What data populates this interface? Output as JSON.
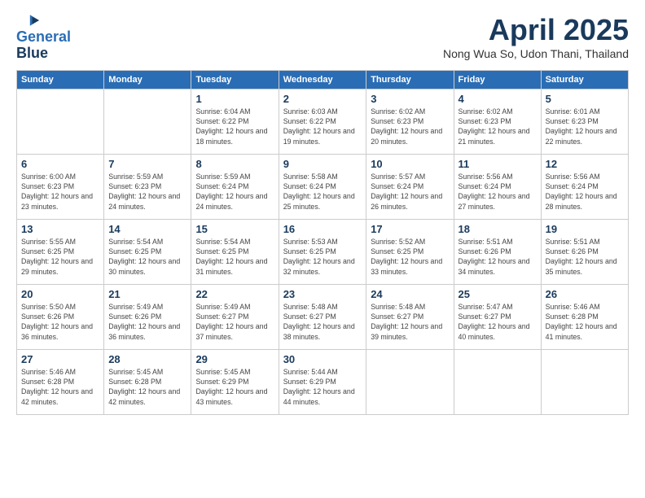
{
  "logo": {
    "line1": "General",
    "line2": "Blue"
  },
  "title": "April 2025",
  "location": "Nong Wua So, Udon Thani, Thailand",
  "days_header": [
    "Sunday",
    "Monday",
    "Tuesday",
    "Wednesday",
    "Thursday",
    "Friday",
    "Saturday"
  ],
  "weeks": [
    [
      {
        "day": "",
        "info": ""
      },
      {
        "day": "",
        "info": ""
      },
      {
        "day": "1",
        "info": "Sunrise: 6:04 AM\nSunset: 6:22 PM\nDaylight: 12 hours and 18 minutes."
      },
      {
        "day": "2",
        "info": "Sunrise: 6:03 AM\nSunset: 6:22 PM\nDaylight: 12 hours and 19 minutes."
      },
      {
        "day": "3",
        "info": "Sunrise: 6:02 AM\nSunset: 6:23 PM\nDaylight: 12 hours and 20 minutes."
      },
      {
        "day": "4",
        "info": "Sunrise: 6:02 AM\nSunset: 6:23 PM\nDaylight: 12 hours and 21 minutes."
      },
      {
        "day": "5",
        "info": "Sunrise: 6:01 AM\nSunset: 6:23 PM\nDaylight: 12 hours and 22 minutes."
      }
    ],
    [
      {
        "day": "6",
        "info": "Sunrise: 6:00 AM\nSunset: 6:23 PM\nDaylight: 12 hours and 23 minutes."
      },
      {
        "day": "7",
        "info": "Sunrise: 5:59 AM\nSunset: 6:23 PM\nDaylight: 12 hours and 24 minutes."
      },
      {
        "day": "8",
        "info": "Sunrise: 5:59 AM\nSunset: 6:24 PM\nDaylight: 12 hours and 24 minutes."
      },
      {
        "day": "9",
        "info": "Sunrise: 5:58 AM\nSunset: 6:24 PM\nDaylight: 12 hours and 25 minutes."
      },
      {
        "day": "10",
        "info": "Sunrise: 5:57 AM\nSunset: 6:24 PM\nDaylight: 12 hours and 26 minutes."
      },
      {
        "day": "11",
        "info": "Sunrise: 5:56 AM\nSunset: 6:24 PM\nDaylight: 12 hours and 27 minutes."
      },
      {
        "day": "12",
        "info": "Sunrise: 5:56 AM\nSunset: 6:24 PM\nDaylight: 12 hours and 28 minutes."
      }
    ],
    [
      {
        "day": "13",
        "info": "Sunrise: 5:55 AM\nSunset: 6:25 PM\nDaylight: 12 hours and 29 minutes."
      },
      {
        "day": "14",
        "info": "Sunrise: 5:54 AM\nSunset: 6:25 PM\nDaylight: 12 hours and 30 minutes."
      },
      {
        "day": "15",
        "info": "Sunrise: 5:54 AM\nSunset: 6:25 PM\nDaylight: 12 hours and 31 minutes."
      },
      {
        "day": "16",
        "info": "Sunrise: 5:53 AM\nSunset: 6:25 PM\nDaylight: 12 hours and 32 minutes."
      },
      {
        "day": "17",
        "info": "Sunrise: 5:52 AM\nSunset: 6:25 PM\nDaylight: 12 hours and 33 minutes."
      },
      {
        "day": "18",
        "info": "Sunrise: 5:51 AM\nSunset: 6:26 PM\nDaylight: 12 hours and 34 minutes."
      },
      {
        "day": "19",
        "info": "Sunrise: 5:51 AM\nSunset: 6:26 PM\nDaylight: 12 hours and 35 minutes."
      }
    ],
    [
      {
        "day": "20",
        "info": "Sunrise: 5:50 AM\nSunset: 6:26 PM\nDaylight: 12 hours and 36 minutes."
      },
      {
        "day": "21",
        "info": "Sunrise: 5:49 AM\nSunset: 6:26 PM\nDaylight: 12 hours and 36 minutes."
      },
      {
        "day": "22",
        "info": "Sunrise: 5:49 AM\nSunset: 6:27 PM\nDaylight: 12 hours and 37 minutes."
      },
      {
        "day": "23",
        "info": "Sunrise: 5:48 AM\nSunset: 6:27 PM\nDaylight: 12 hours and 38 minutes."
      },
      {
        "day": "24",
        "info": "Sunrise: 5:48 AM\nSunset: 6:27 PM\nDaylight: 12 hours and 39 minutes."
      },
      {
        "day": "25",
        "info": "Sunrise: 5:47 AM\nSunset: 6:27 PM\nDaylight: 12 hours and 40 minutes."
      },
      {
        "day": "26",
        "info": "Sunrise: 5:46 AM\nSunset: 6:28 PM\nDaylight: 12 hours and 41 minutes."
      }
    ],
    [
      {
        "day": "27",
        "info": "Sunrise: 5:46 AM\nSunset: 6:28 PM\nDaylight: 12 hours and 42 minutes."
      },
      {
        "day": "28",
        "info": "Sunrise: 5:45 AM\nSunset: 6:28 PM\nDaylight: 12 hours and 42 minutes."
      },
      {
        "day": "29",
        "info": "Sunrise: 5:45 AM\nSunset: 6:29 PM\nDaylight: 12 hours and 43 minutes."
      },
      {
        "day": "30",
        "info": "Sunrise: 5:44 AM\nSunset: 6:29 PM\nDaylight: 12 hours and 44 minutes."
      },
      {
        "day": "",
        "info": ""
      },
      {
        "day": "",
        "info": ""
      },
      {
        "day": "",
        "info": ""
      }
    ]
  ]
}
